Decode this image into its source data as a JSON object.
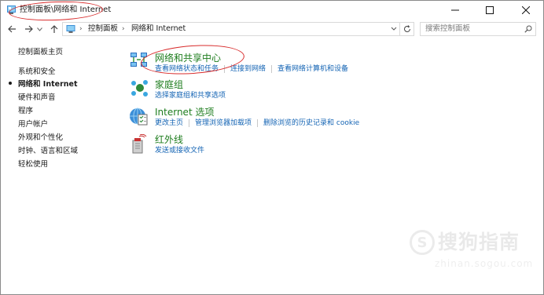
{
  "window": {
    "title": "控制面板\\网络和 Internet"
  },
  "nav": {
    "breadcrumbs": [
      "控制面板",
      "网络和 Internet"
    ],
    "search_placeholder": "搜索控制面板"
  },
  "sidebar": {
    "items": [
      {
        "label": "控制面板主页",
        "active": false
      },
      {
        "label": "系统和安全",
        "active": false
      },
      {
        "label": "网络和 Internet",
        "active": true
      },
      {
        "label": "硬件和声音",
        "active": false
      },
      {
        "label": "程序",
        "active": false
      },
      {
        "label": "用户帐户",
        "active": false
      },
      {
        "label": "外观和个性化",
        "active": false
      },
      {
        "label": "时钟、语言和区域",
        "active": false
      },
      {
        "label": "轻松使用",
        "active": false
      }
    ]
  },
  "categories": [
    {
      "title": "网络和共享中心",
      "icon": "network-sharing-icon",
      "links": [
        "查看网络状态和任务",
        "连接到网络",
        "查看网络计算机和设备"
      ]
    },
    {
      "title": "家庭组",
      "icon": "homegroup-icon",
      "links": [
        "选择家庭组和共享选项"
      ]
    },
    {
      "title": "Internet 选项",
      "icon": "internet-options-icon",
      "links": [
        "更改主页",
        "管理浏览器加载项",
        "删除浏览的历史记录和 cookie"
      ]
    },
    {
      "title": "红外线",
      "icon": "infrared-icon",
      "links": [
        "发送或接收文件"
      ]
    }
  ],
  "watermark": {
    "logo": "S",
    "text": "搜狗指南",
    "url": "zhinan.sogou.com"
  },
  "colors": {
    "category_title": "#1e7d1e",
    "link": "#1464b4",
    "annotation": "#d82b2b"
  }
}
